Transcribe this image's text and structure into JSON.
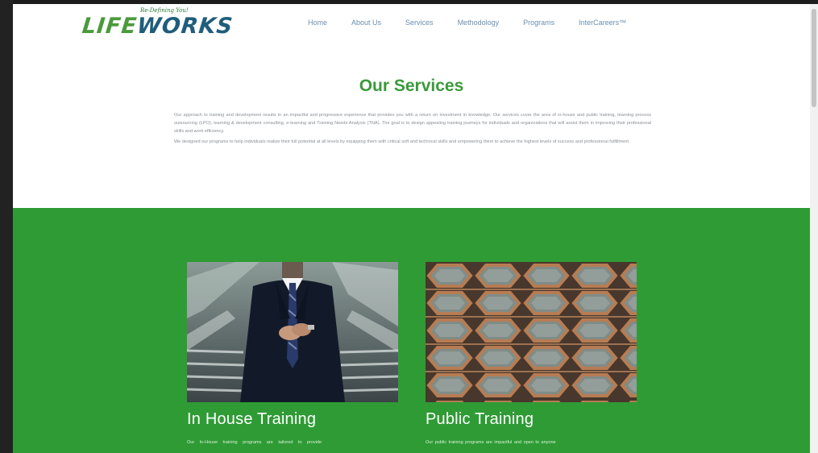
{
  "logo": {
    "tagline": "Re-Defining You!",
    "text_life": "LIFE",
    "text_works": "WORKS"
  },
  "nav": {
    "items": [
      "Home",
      "About Us",
      "Services",
      "Methodology",
      "Programs",
      "InterCareers™"
    ]
  },
  "intro": {
    "title": "Our Services",
    "paragraph_1": "Our approach to training and development results in an impactful and progressive experience that provides you with a return on investment in knowledge. Our services cover the area of in-house and public training, learning process outsourcing (LPO), learning & development consulting, e-learning and Training Needs Analysis (TNA). The goal is to design appealing training journeys for individuals and organizations that will assist them in improving their professional skills and work efficiency.",
    "paragraph_2": "We designed our programs to help individuals realize their full potential at all levels by equipping them with critical soft and technical skills and empowering them to achieve the highest levels of success and professional fulfillment."
  },
  "cards": [
    {
      "title": "In House Training",
      "desc": "Our In-House training programs are tailored to provide",
      "image": "businessman-suit-photo"
    },
    {
      "title": "Public Training",
      "desc": "Our public training programs are impactful and open to anyone",
      "image": "honeycomb-architecture-photo"
    }
  ],
  "colors": {
    "green_band": "#2f9b35",
    "title_green": "#3a9a3a",
    "nav_blue": "#6a8fb0"
  }
}
